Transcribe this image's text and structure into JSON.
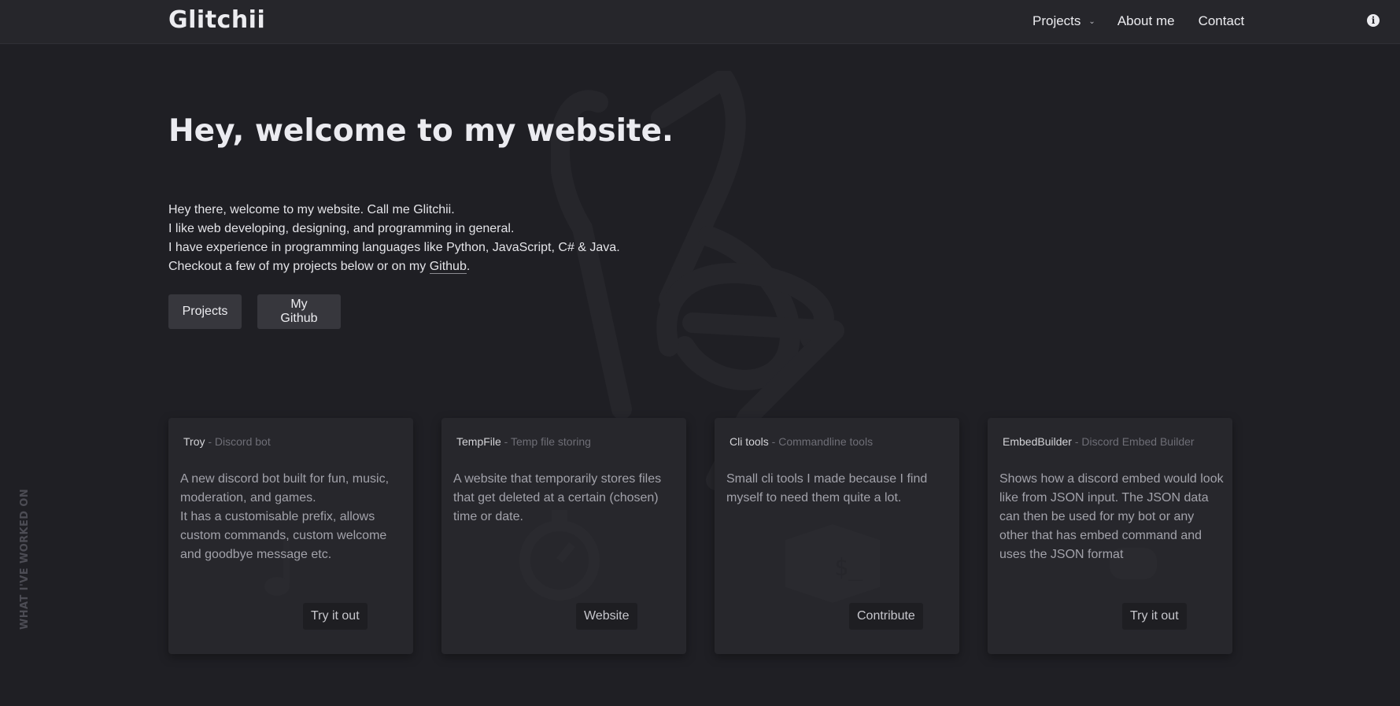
{
  "nav": {
    "brand": "Glitchii",
    "projects": "Projects",
    "about": "About me",
    "contact": "Contact",
    "info_icon": "info-icon"
  },
  "hero": {
    "title": "Hey, welcome to my website.",
    "lines": [
      "Hey there, welcome to my website. Call me Glitchii.",
      "I like web developing, designing, and programming in general.",
      "I have experience in programming languages like Python, JavaScript, C# & Java."
    ],
    "checkout_prefix": "Checkout a few of my projects below or on my ",
    "github_link": "Github",
    "checkout_suffix": ".",
    "btn_projects": "Projects",
    "btn_github": "My Github"
  },
  "side_label": "WHAT I'VE WORKED ON",
  "cards": [
    {
      "name": "Troy",
      "subtitle": " - Discord bot",
      "desc": [
        "A new discord bot built for fun, music, moderation, and games.",
        "It has a customisable prefix, allows custom commands, custom welcome and goodbye message etc."
      ],
      "button": "Try it out",
      "icon": "music-note-icon"
    },
    {
      "name": "TempFile",
      "subtitle": " - Temp file storing",
      "desc": [
        "A website that temporarily stores files that get deleted at a certain (chosen) time or date."
      ],
      "button": "Website",
      "icon": "stopwatch-icon"
    },
    {
      "name": "Cli tools",
      "subtitle": " - Commandline tools",
      "desc": [
        "Small cli tools I made because I find myself to need them quite a lot."
      ],
      "button": "Contribute",
      "icon": "terminal-icon"
    },
    {
      "name": "EmbedBuilder",
      "subtitle": " - Discord Embed Builder",
      "desc": [
        "Shows how a discord embed would look like from JSON input. The JSON data can then be used for my bot or any other that has embed command and uses the JSON format"
      ],
      "button": "Try it out",
      "icon": "discord-icon"
    }
  ]
}
